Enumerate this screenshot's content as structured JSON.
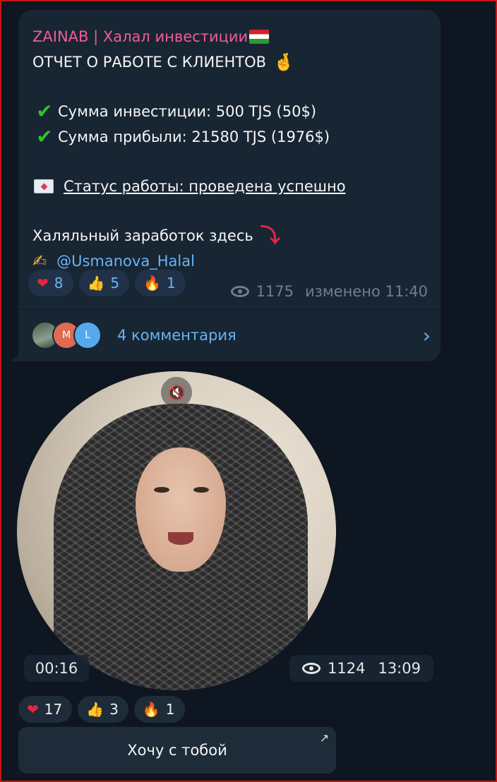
{
  "post": {
    "sender": "ZAINAB | Халал инвестиции",
    "title": "ОТЧЕТ О РАБОТЕ С КЛИЕНТОВ",
    "investment_line": "Сумма инвестиции: 500 TJS (50$)",
    "profit_line": " Сумма прибыли: 21580 TJS (1976$)",
    "status_line": "Статус работы: проведена успешно",
    "earn_line": "Халяльный заработок здесь",
    "mention": "@Usmanova_Halal",
    "reactions": [
      {
        "icon": "heart-icon",
        "count": "8"
      },
      {
        "icon": "thumbs-up-icon",
        "count": "5"
      },
      {
        "icon": "fire-icon",
        "count": "1"
      }
    ],
    "views": "1175",
    "edited_time": "изменено 11:40",
    "comments_label": "4 комментария",
    "comment_avatars": [
      "",
      "M",
      "L"
    ]
  },
  "video_message": {
    "duration": "00:16",
    "views": "1124",
    "time": "13:09",
    "reactions": [
      {
        "icon": "heart-icon",
        "count": "17"
      },
      {
        "icon": "thumbs-up-icon",
        "count": "3"
      },
      {
        "icon": "fire-icon",
        "count": "1"
      }
    ],
    "button_label": "Хочу с тобой"
  },
  "colors": {
    "background": "#0e1621",
    "bubble": "#182533",
    "sender": "#ee5c9b",
    "link": "#6ab3f3"
  }
}
